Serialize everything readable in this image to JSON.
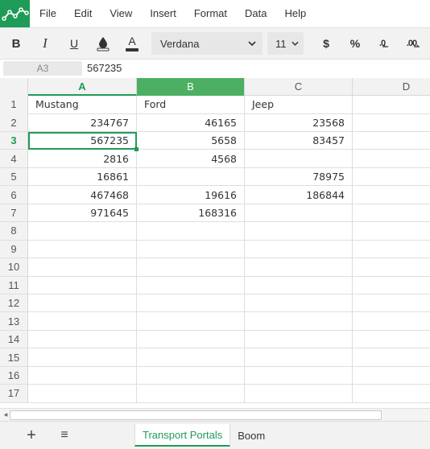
{
  "menu": [
    "File",
    "Edit",
    "View",
    "Insert",
    "Format",
    "Data",
    "Help"
  ],
  "toolbar": {
    "bold": "B",
    "italic": "I",
    "underline": "U",
    "text_color": "A",
    "font": "Verdana",
    "size": "11",
    "currency": "$",
    "percent": "%",
    "dec_decrease": ".0",
    "dec_increase": ".00"
  },
  "formula": {
    "cell_ref": "A3",
    "value": "567235"
  },
  "columns": [
    "A",
    "B",
    "C",
    "D"
  ],
  "rows": [
    {
      "num": "1",
      "cells": [
        "Mustang",
        "Ford",
        "Jeep",
        ""
      ]
    },
    {
      "num": "2",
      "cells": [
        "234767",
        "46165",
        "23568",
        ""
      ]
    },
    {
      "num": "3",
      "cells": [
        "567235",
        "5658",
        "83457",
        ""
      ]
    },
    {
      "num": "4",
      "cells": [
        "2816",
        "4568",
        "",
        ""
      ]
    },
    {
      "num": "5",
      "cells": [
        "16861",
        "",
        "78975",
        ""
      ]
    },
    {
      "num": "6",
      "cells": [
        "467468",
        "19616",
        "186844",
        ""
      ]
    },
    {
      "num": "7",
      "cells": [
        "971645",
        "168316",
        "",
        ""
      ]
    },
    {
      "num": "8",
      "cells": [
        "",
        "",
        "",
        ""
      ]
    },
    {
      "num": "9",
      "cells": [
        "",
        "",
        "",
        ""
      ]
    },
    {
      "num": "10",
      "cells": [
        "",
        "",
        "",
        ""
      ]
    },
    {
      "num": "11",
      "cells": [
        "",
        "",
        "",
        ""
      ]
    },
    {
      "num": "12",
      "cells": [
        "",
        "",
        "",
        ""
      ]
    },
    {
      "num": "13",
      "cells": [
        "",
        "",
        "",
        ""
      ]
    },
    {
      "num": "14",
      "cells": [
        "",
        "",
        "",
        ""
      ]
    },
    {
      "num": "15",
      "cells": [
        "",
        "",
        "",
        ""
      ]
    },
    {
      "num": "16",
      "cells": [
        "",
        "",
        "",
        ""
      ]
    },
    {
      "num": "17",
      "cells": [
        "",
        "",
        "",
        ""
      ]
    }
  ],
  "selection": {
    "row": 3,
    "col": "A"
  },
  "sheets": [
    "Transport Portals",
    "Boom"
  ],
  "colors": {
    "accent": "#1e9c57",
    "selected_col_header": "#4caf62"
  }
}
